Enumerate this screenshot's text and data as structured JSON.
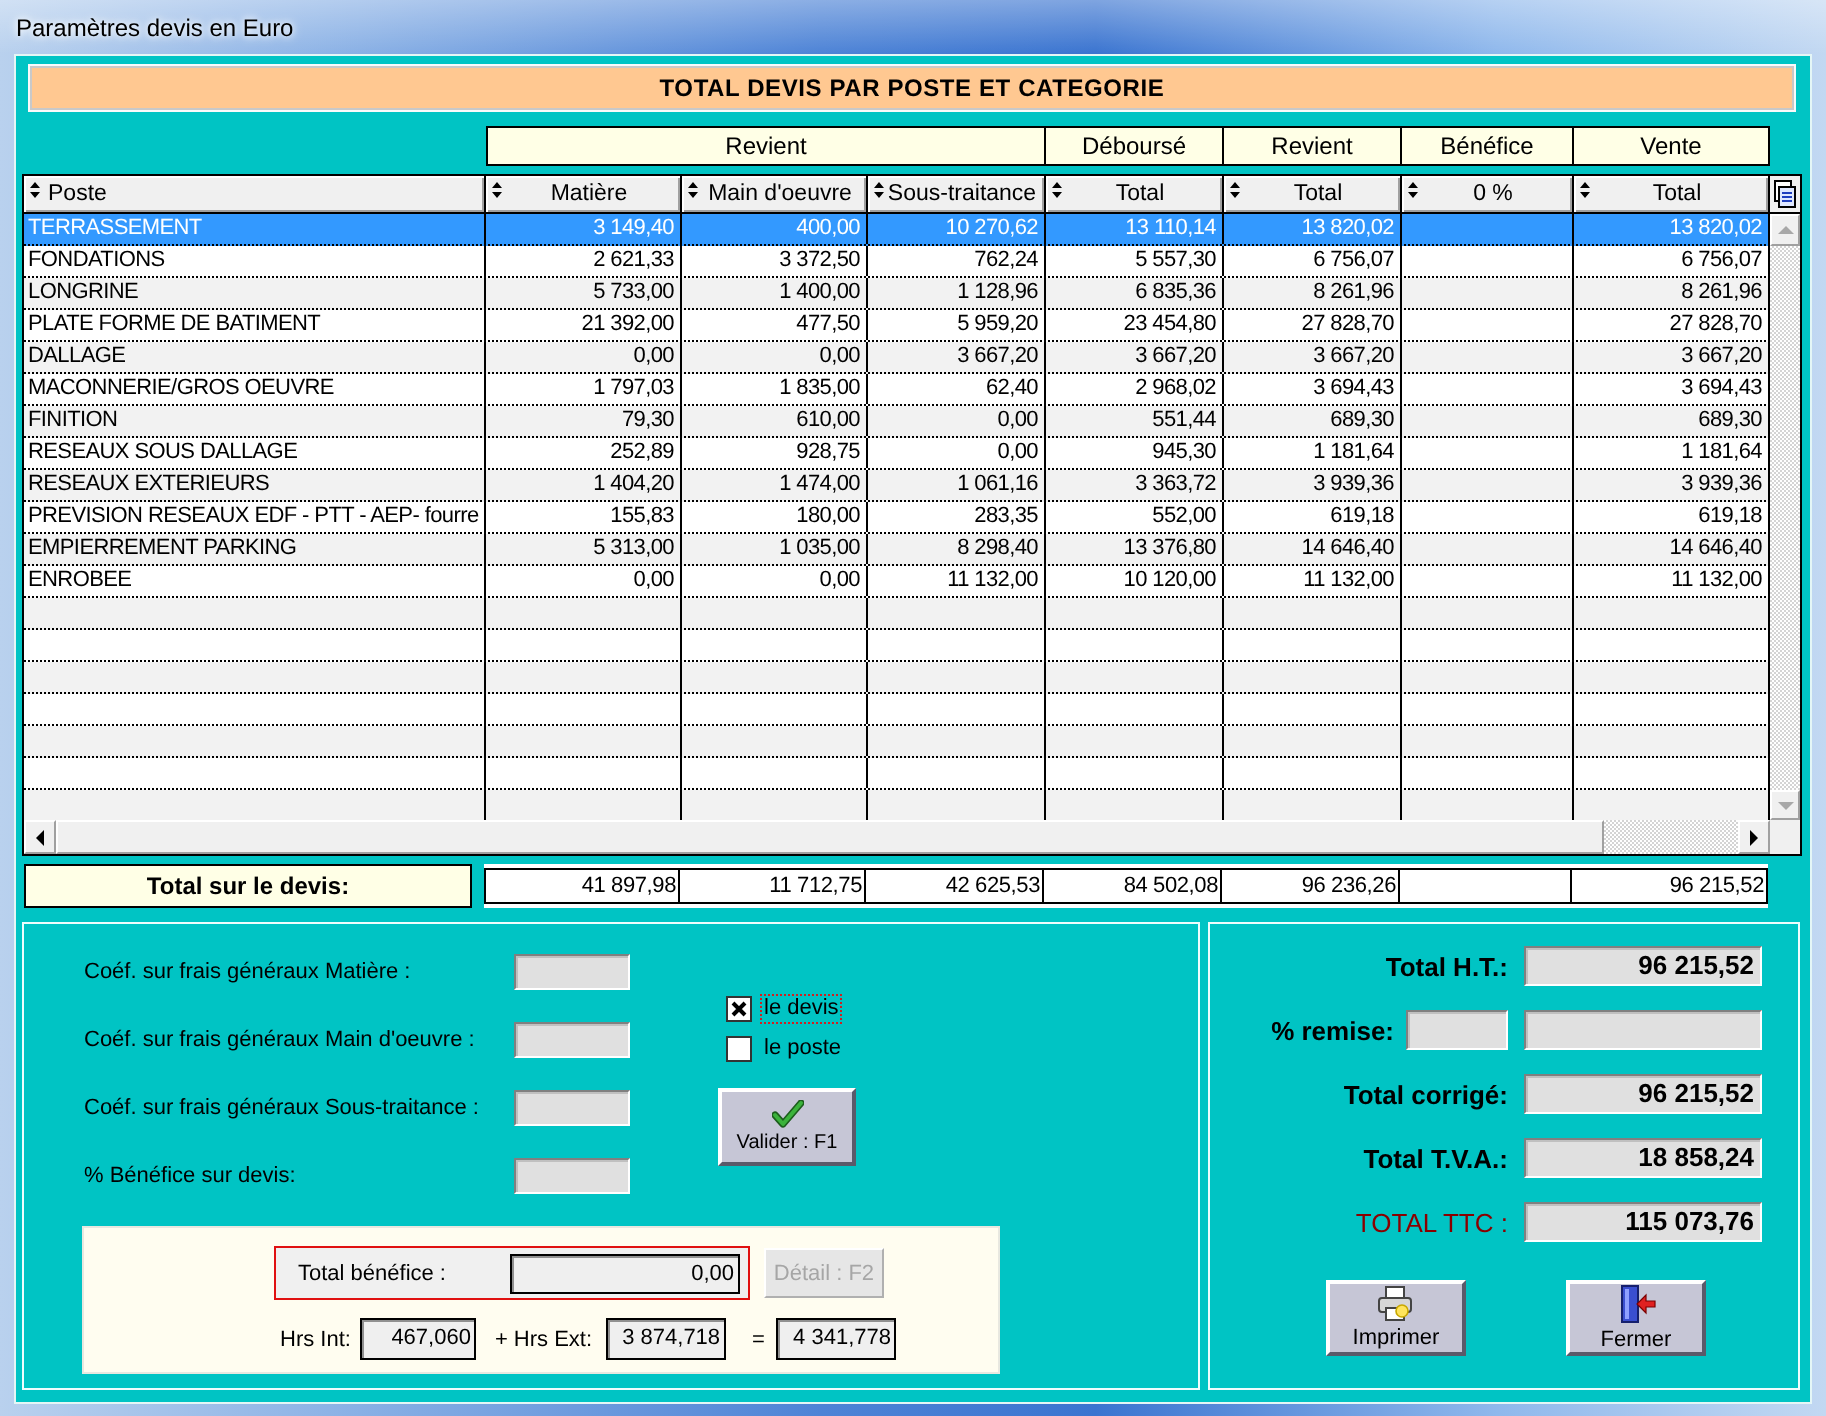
{
  "window": {
    "title": "Paramètres devis en Euro"
  },
  "banner": "TOTAL DEVIS PAR POSTE ET CATEGORIE",
  "table": {
    "first_column": "Poste",
    "groups": [
      {
        "label": "Revient",
        "columns": [
          {
            "label": "Matière",
            "kind": "amount"
          },
          {
            "label": "Main d'oeuvre",
            "kind": "amount"
          },
          {
            "label": "Sous-traitance",
            "kind": "amount"
          }
        ]
      },
      {
        "label": "Déboursé",
        "columns": [
          {
            "label": "Total",
            "kind": "amount"
          }
        ]
      },
      {
        "label": "Revient",
        "columns": [
          {
            "label": "Total",
            "kind": "amount"
          }
        ]
      },
      {
        "label": "Bénéfice",
        "columns": [
          {
            "label": "0 %",
            "kind": "blank"
          }
        ]
      },
      {
        "label": "Vente",
        "columns": [
          {
            "label": "Total",
            "kind": "amount"
          }
        ]
      }
    ],
    "rows": [
      {
        "poste": "TERRASSEMENT",
        "selected": true,
        "values": [
          "3 149,40",
          "400,00",
          "10 270,62",
          "13 110,14",
          "13 820,02",
          "13 820,02"
        ]
      },
      {
        "poste": "FONDATIONS",
        "selected": false,
        "values": [
          "2 621,33",
          "3 372,50",
          "762,24",
          "5 557,30",
          "6 756,07",
          "6 756,07"
        ]
      },
      {
        "poste": "LONGRINE",
        "selected": false,
        "values": [
          "5 733,00",
          "1 400,00",
          "1 128,96",
          "6 835,36",
          "8 261,96",
          "8 261,96"
        ]
      },
      {
        "poste": "PLATE FORME DE BATIMENT",
        "selected": false,
        "values": [
          "21 392,00",
          "477,50",
          "5 959,20",
          "23 454,80",
          "27 828,70",
          "27 828,70"
        ]
      },
      {
        "poste": "DALLAGE",
        "selected": false,
        "values": [
          "0,00",
          "0,00",
          "3 667,20",
          "3 667,20",
          "3 667,20",
          "3 667,20"
        ]
      },
      {
        "poste": "MACONNERIE/GROS OEUVRE",
        "selected": false,
        "values": [
          "1 797,03",
          "1 835,00",
          "62,40",
          "2 968,02",
          "3 694,43",
          "3 694,43"
        ]
      },
      {
        "poste": "FINITION",
        "selected": false,
        "values": [
          "79,30",
          "610,00",
          "0,00",
          "551,44",
          "689,30",
          "689,30"
        ]
      },
      {
        "poste": "RESEAUX SOUS DALLAGE",
        "selected": false,
        "values": [
          "252,89",
          "928,75",
          "0,00",
          "945,30",
          "1 181,64",
          "1 181,64"
        ]
      },
      {
        "poste": "RESEAUX EXTERIEURS",
        "selected": false,
        "values": [
          "1 404,20",
          "1 474,00",
          "1 061,16",
          "3 363,72",
          "3 939,36",
          "3 939,36"
        ]
      },
      {
        "poste": "PREVISION RESEAUX EDF - PTT - AEP- fourre",
        "selected": false,
        "values": [
          "155,83",
          "180,00",
          "283,35",
          "552,00",
          "619,18",
          "619,18"
        ]
      },
      {
        "poste": "EMPIERREMENT PARKING",
        "selected": false,
        "values": [
          "5 313,00",
          "1 035,00",
          "8 298,40",
          "13 376,80",
          "14 646,40",
          "14 646,40"
        ]
      },
      {
        "poste": "ENROBEE",
        "selected": false,
        "values": [
          "0,00",
          "0,00",
          "11 132,00",
          "10 120,00",
          "11 132,00",
          "11 132,00"
        ]
      }
    ],
    "totals": {
      "label": "Total sur le devis:",
      "values": [
        "41 897,98",
        "11 712,75",
        "42 625,53",
        "84 502,08",
        "96 236,26",
        "96 215,52"
      ]
    }
  },
  "coefficients": [
    {
      "label": "Coéf. sur frais généraux Matière :"
    },
    {
      "label": "Coéf. sur frais généraux Main d'oeuvre :"
    },
    {
      "label": "Coéf. sur frais généraux Sous-traitance :"
    },
    {
      "label": "% Bénéfice sur devis:"
    }
  ],
  "apply_to": [
    {
      "label": "le devis",
      "checked": true,
      "focused": true
    },
    {
      "label": "le poste",
      "checked": false,
      "focused": false
    }
  ],
  "validate_button": {
    "label": "Valider : F1"
  },
  "benefit": {
    "label": "Total bénéfice :",
    "value": "0,00",
    "detail_button": {
      "label": "Détail : F2",
      "disabled": true
    }
  },
  "hours": {
    "internal_label": "Hrs Int:",
    "internal": "467,060",
    "external_label": "+ Hrs Ext:",
    "external": "3 874,718",
    "equals": "=",
    "total": "4 341,778"
  },
  "summary": [
    {
      "kind": "total",
      "label": "Total H.T.:",
      "value": "96 215,52"
    },
    {
      "kind": "discount",
      "label": "% remise:"
    },
    {
      "kind": "total",
      "label": "Total corrigé:",
      "value": "96 215,52"
    },
    {
      "kind": "total",
      "label": "Total T.V.A.:",
      "value": "18 858,24"
    },
    {
      "kind": "grand_total",
      "label": "TOTAL TTC :",
      "value": "115 073,76"
    }
  ],
  "buttons": [
    {
      "kind": "print",
      "label": "Imprimer"
    },
    {
      "kind": "close",
      "label": "Fermer"
    }
  ]
}
